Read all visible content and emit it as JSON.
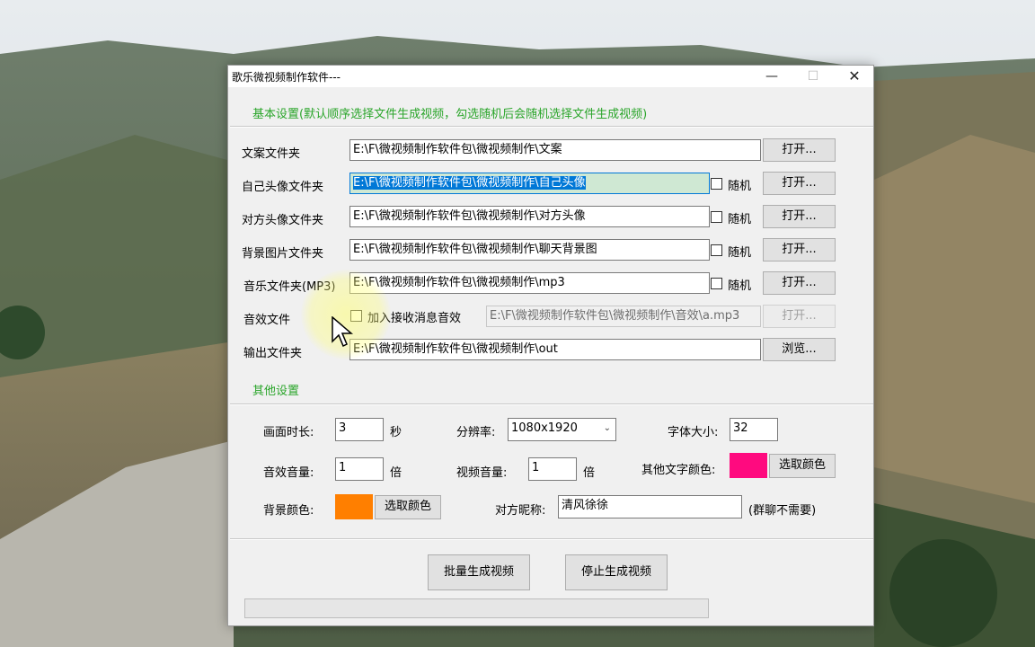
{
  "window": {
    "title": "歌乐微视频制作软件---",
    "controls": {
      "minimize": "—",
      "maximize": "☐",
      "close": "✕"
    }
  },
  "basic_settings": {
    "header": "基本设置(默认顺序选择文件生成视频，勾选随机后会随机选择文件生成视频)",
    "rows": [
      {
        "label": "文案文件夹",
        "path": "E:\\F\\微视频制作软件包\\微视频制作\\文案",
        "button": "打开..."
      },
      {
        "label": "自己头像文件夹",
        "path": "E:\\F\\微视频制作软件包\\微视频制作\\自己头像",
        "random": "随机",
        "button": "打开..."
      },
      {
        "label": "对方头像文件夹",
        "path": "E:\\F\\微视频制作软件包\\微视频制作\\对方头像",
        "random": "随机",
        "button": "打开..."
      },
      {
        "label": "背景图片文件夹",
        "path": "E:\\F\\微视频制作软件包\\微视频制作\\聊天背景图",
        "random": "随机",
        "button": "打开..."
      },
      {
        "label": "音乐文件夹(MP3)",
        "path": "E:\\F\\微视频制作软件包\\微视频制作\\mp3",
        "random": "随机",
        "button": "打开..."
      },
      {
        "label": "音效文件",
        "checkbox": "加入接收消息音效",
        "path": "E:\\F\\微视频制作软件包\\微视频制作\\音效\\a.mp3",
        "button": "打开..."
      },
      {
        "label": "输出文件夹",
        "path": "E:\\F\\微视频制作软件包\\微视频制作\\out",
        "button": "浏览..."
      }
    ]
  },
  "other_settings": {
    "header": "其他设置",
    "duration": {
      "label": "画面时长:",
      "value": "3",
      "unit": "秒"
    },
    "resolution": {
      "label": "分辨率:",
      "value": "1080x1920"
    },
    "font_size": {
      "label": "字体大小:",
      "value": "32"
    },
    "sfx_volume": {
      "label": "音效音量:",
      "value": "1",
      "unit": "倍"
    },
    "video_volume": {
      "label": "视频音量:",
      "value": "1",
      "unit": "倍"
    },
    "other_text_color": {
      "label": "其他文字颜色:",
      "color": "#ff0a7f",
      "button": "选取颜色"
    },
    "bg_color": {
      "label": "背景颜色:",
      "color": "#ff7f00",
      "button": "选取颜色"
    },
    "peer_nickname": {
      "label": "对方昵称:",
      "value": "清风徐徐",
      "note": "(群聊不需要)"
    }
  },
  "actions": {
    "batch_generate": "批量生成视频",
    "stop_generate": "停止生成视频",
    "progress": 0
  },
  "colors": {
    "section_green": "#2aa52a",
    "selection_blue": "#0078d7"
  }
}
